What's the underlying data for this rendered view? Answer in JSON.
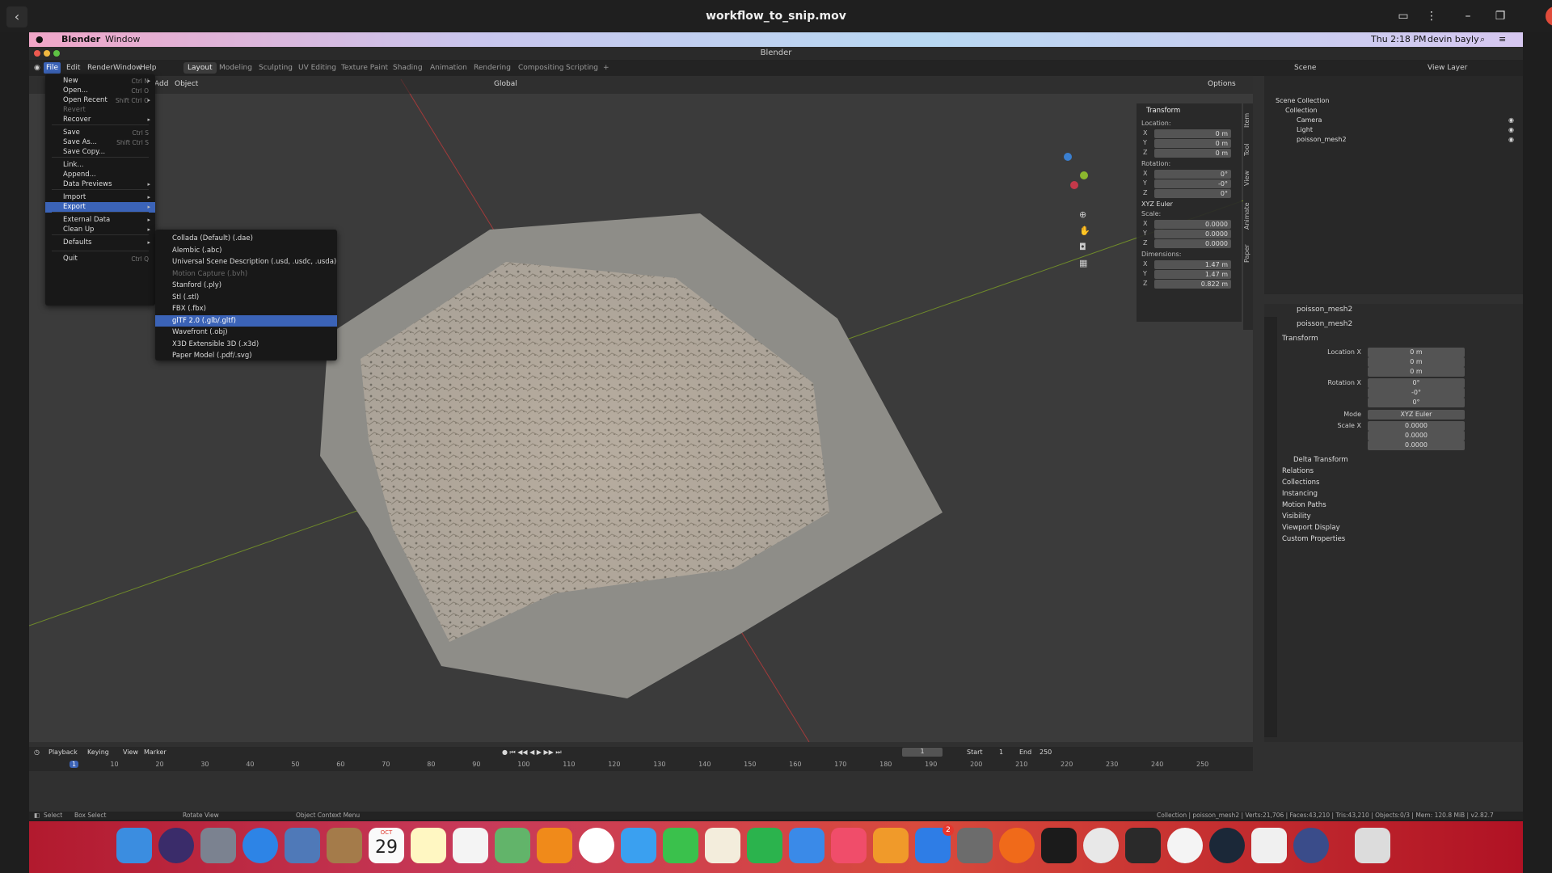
{
  "player": {
    "title": "workflow_to_snip.mov"
  },
  "mac_menubar": {
    "app": "Blender",
    "menu": "Window",
    "clock": "Thu 2:18 PM",
    "user": "devin bayly"
  },
  "window": {
    "title": "Blender"
  },
  "topbar": {
    "menus": [
      "File",
      "Edit",
      "Render",
      "Window",
      "Help"
    ],
    "workspaces": [
      "Layout",
      "Modeling",
      "Sculpting",
      "UV Editing",
      "Texture Paint",
      "Shading",
      "Animation",
      "Rendering",
      "Compositing",
      "Scripting"
    ],
    "active_workspace": "Layout",
    "scene_label": "Scene",
    "view_layer_label": "View Layer"
  },
  "viewport_header": {
    "add": "Add",
    "object": "Object",
    "transform_orientation": "Global",
    "options": "Options"
  },
  "file_menu": {
    "items": [
      {
        "label": "New",
        "shortcut": "Ctrl N",
        "arrow": true
      },
      {
        "label": "Open...",
        "shortcut": "Ctrl O"
      },
      {
        "label": "Open Recent",
        "shortcut": "Shift Ctrl O",
        "arrow": true
      },
      {
        "label": "Revert",
        "dim": true
      },
      {
        "label": "Recover",
        "arrow": true
      },
      {
        "label": "Save",
        "shortcut": "Ctrl S"
      },
      {
        "label": "Save As...",
        "shortcut": "Shift Ctrl S"
      },
      {
        "label": "Save Copy..."
      },
      {
        "label": "Link..."
      },
      {
        "label": "Append..."
      },
      {
        "label": "Data Previews",
        "arrow": true
      },
      {
        "label": "Import",
        "arrow": true
      },
      {
        "label": "Export",
        "arrow": true,
        "highlight": true
      },
      {
        "label": "External Data",
        "arrow": true
      },
      {
        "label": "Clean Up",
        "arrow": true
      },
      {
        "label": "Defaults",
        "arrow": true
      },
      {
        "label": "Quit",
        "shortcut": "Ctrl Q"
      }
    ]
  },
  "export_menu": {
    "items": [
      {
        "label": "Collada (Default) (.dae)"
      },
      {
        "label": "Alembic (.abc)"
      },
      {
        "label": "Universal Scene Description (.usd, .usdc, .usda)"
      },
      {
        "label": "Motion Capture (.bvh)",
        "dim": true
      },
      {
        "label": "Stanford (.ply)"
      },
      {
        "label": "Stl (.stl)"
      },
      {
        "label": "FBX (.fbx)"
      },
      {
        "label": "glTF 2.0 (.glb/.gltf)",
        "highlight": true
      },
      {
        "label": "Wavefront (.obj)"
      },
      {
        "label": "X3D Extensible 3D (.x3d)"
      },
      {
        "label": "Paper Model (.pdf/.svg)"
      }
    ]
  },
  "npanel": {
    "header": "Transform",
    "location_label": "Location:",
    "location": [
      "0 m",
      "0 m",
      "0 m"
    ],
    "rotation_label": "Rotation:",
    "rotation": [
      "0°",
      "-0°",
      "0°"
    ],
    "rotation_mode": "XYZ Euler",
    "scale_label": "Scale:",
    "scale": [
      "0.0000",
      "0.0000",
      "0.0000"
    ],
    "dimensions_label": "Dimensions:",
    "dimensions": [
      "1.47 m",
      "1.47 m",
      "0.822 m"
    ],
    "tabs": [
      "Item",
      "Tool",
      "View",
      "Animate",
      "Paper"
    ]
  },
  "outliner": {
    "root": "Scene Collection",
    "collection": "Collection",
    "items": [
      "Camera",
      "Light",
      "poisson_mesh2"
    ]
  },
  "properties": {
    "object_name": "poisson_mesh2",
    "datablock_name": "poisson_mesh2",
    "transform_header": "Transform",
    "location_x_label": "Location X",
    "location": [
      "0 m",
      "0 m",
      "0 m"
    ],
    "rotation_x_label": "Rotation X",
    "rotation": [
      "0°",
      "-0°",
      "0°"
    ],
    "mode_label": "Mode",
    "mode": "XYZ Euler",
    "scale_x_label": "Scale X",
    "scale": [
      "0.0000",
      "0.0000",
      "0.0000"
    ],
    "sections": [
      "Delta Transform",
      "Relations",
      "Collections",
      "Instancing",
      "Motion Paths",
      "Visibility",
      "Viewport Display",
      "Custom Properties"
    ]
  },
  "timeline": {
    "menus": [
      "Playback",
      "Keying",
      "View",
      "Marker"
    ],
    "current_frame": "1",
    "start_label": "Start",
    "start": "1",
    "end_label": "End",
    "end": "250",
    "ticks": [
      "1",
      "10",
      "20",
      "30",
      "40",
      "50",
      "60",
      "70",
      "80",
      "90",
      "100",
      "110",
      "120",
      "130",
      "140",
      "150",
      "160",
      "170",
      "180",
      "190",
      "200",
      "210",
      "220",
      "230",
      "240",
      "250"
    ]
  },
  "statusbar": {
    "select": "Select",
    "box_select": "Box Select",
    "rotate_view": "Rotate View",
    "context_menu": "Object Context Menu",
    "stats": "Collection | poisson_mesh2 | Verts:21,706 | Faces:43,210 | Tris:43,210 | Objects:0/3 | Mem: 120.8 MiB | v2.82.7"
  },
  "dock": {
    "date_month": "OCT",
    "date_day": "29",
    "badge": "2"
  }
}
